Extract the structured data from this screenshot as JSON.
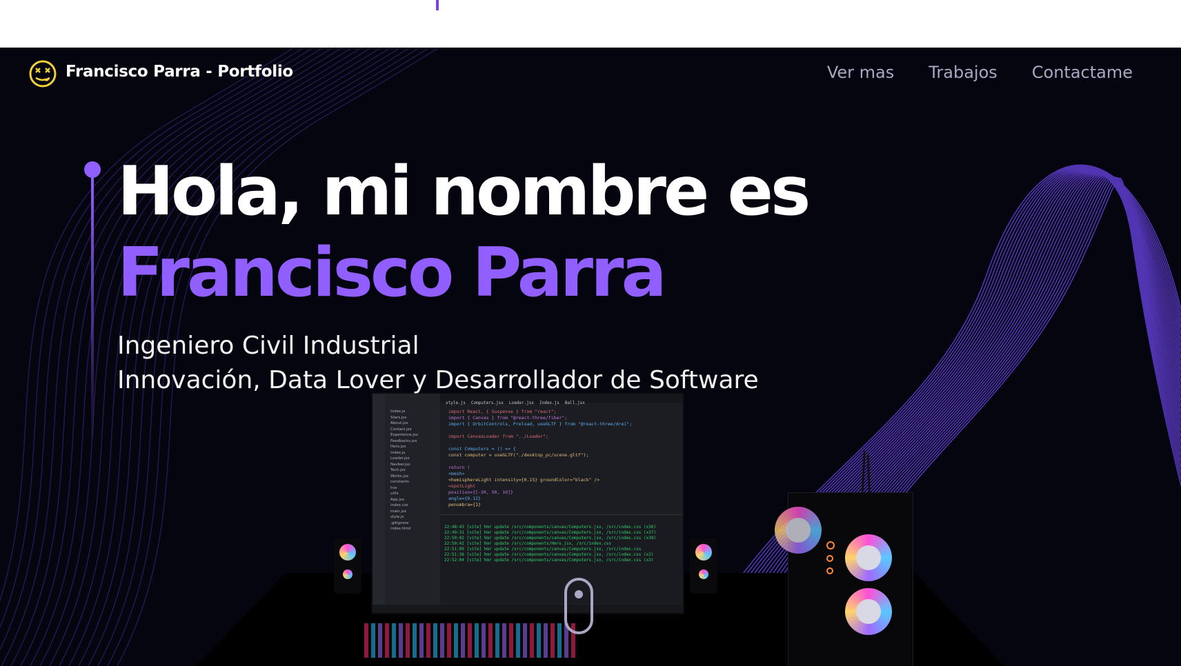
{
  "navbar": {
    "brand": "Francisco Parra - Portfolio",
    "links": [
      "Ver mas",
      "Trabajos",
      "Contactame"
    ]
  },
  "hero": {
    "title_line": "Hola, mi nombre es",
    "name": "Francisco Parra",
    "subtitle_lines": [
      "Ingeniero Civil Industrial",
      "Innovación, Data Lover y Desarrollador de Software"
    ]
  },
  "editor": {
    "tabs": [
      "style.js",
      "Computers.jsx",
      "Loader.jsx",
      "Index.js",
      "Ball.jsx"
    ],
    "explorer": [
      "Index.js",
      "Stars.jsx",
      "About.jsx",
      "Contact.jsx",
      "Experience.jsx",
      "Feedbacks.jsx",
      "Hero.jsx",
      "Index.js",
      "Loader.jsx",
      "Navbar.jsx",
      "Tech.jsx",
      "Works.jsx",
      "constants",
      "hoc",
      "utils",
      "App.jsx",
      "index.css",
      "main.jsx",
      "style.js",
      ".gitignore",
      "index.html"
    ],
    "code": [
      "import React, { Suspense } from \"react\";",
      "import { Canvas } from \"@react-three/fiber\";",
      "import { OrbitControls, Preload, useGLTF } from \"@react-three/drei\";",
      "",
      "import CanvasLoader from \"../Loader\";",
      "",
      "const Computers = () => {",
      "  const computer = useGLTF(\"./desktop_pc/scene.gltf\");",
      "",
      "  return (",
      "    <mesh>",
      "      <hemisphereLight intensity={0.15} groundColor=\"black\" />",
      "      <spotLight",
      "        position={[-20, 50, 10]}",
      "        angle={0.12}",
      "        penumbra={1}"
    ],
    "terminal": [
      "22:48:43 [vite] hmr update /src/components/canvas/Computers.jsx, /src/index.css (x36)",
      "22:49:31 [vite] hmr update /src/components/canvas/Computers.jsx, /src/index.css (x37)",
      "22:50:02 [vite] hmr update /src/components/canvas/Computers.jsx, /src/index.css (x38)",
      "22:50:42 [vite] hmr update /src/components/Hero.jsx, /src/index.css",
      "22:51:09 [vite] hmr update /src/components/canvas/Computers.jsx, /src/index.css",
      "22:51:36 [vite] hmr update /src/components/canvas/Computers.jsx, /src/index.css (x2)",
      "22:52:04 [vite] hmr update /src/components/canvas/Computers.jsx, /src/index.css (x3)"
    ]
  },
  "colors": {
    "accent": "#915eff",
    "background": "#050510",
    "nav_text": "#aaa6c3"
  }
}
